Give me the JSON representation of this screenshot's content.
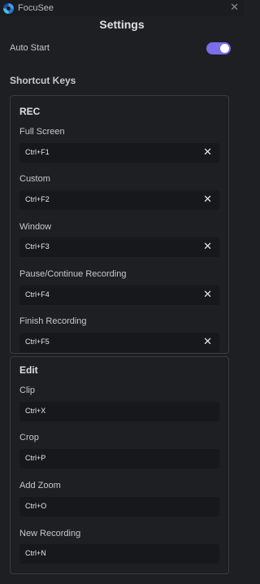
{
  "app": {
    "name": "FocuSee"
  },
  "page": {
    "title": "Settings"
  },
  "auto_start": {
    "label": "Auto Start",
    "enabled": true,
    "accent_color": "#7b6ee8"
  },
  "shortcuts": {
    "section_label": "Shortcut Keys",
    "rec": {
      "title": "REC",
      "items": [
        {
          "label": "Full Screen",
          "key": "Ctrl+F1",
          "clear_icon": "close-icon"
        },
        {
          "label": "Custom",
          "key": "Ctrl+F2",
          "clear_icon": "close-icon"
        },
        {
          "label": "Window",
          "key": "Ctrl+F3",
          "clear_icon": "close-icon"
        },
        {
          "label": "Pause/Continue Recording",
          "key": "Ctrl+F4",
          "clear_icon": "close-icon"
        },
        {
          "label": "Finish Recording",
          "key": "Ctrl+F5",
          "clear_icon": "close-icon"
        }
      ]
    },
    "edit": {
      "title": "Edit",
      "items": [
        {
          "label": "Clip",
          "key": "Ctrl+X"
        },
        {
          "label": "Crop",
          "key": "Ctrl+P"
        },
        {
          "label": "Add Zoom",
          "key": "Ctrl+O"
        },
        {
          "label": "New Recording",
          "key": "Ctrl+N"
        }
      ]
    }
  }
}
